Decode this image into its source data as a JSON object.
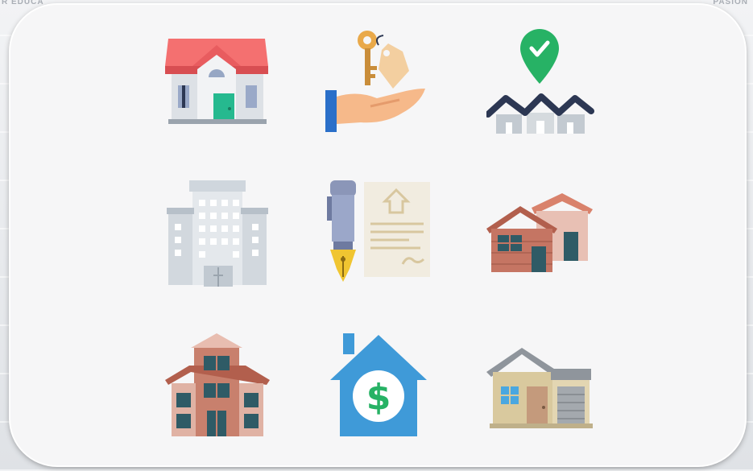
{
  "background": {
    "left_text": "R EDUCA",
    "right_text": "PASION"
  },
  "icons": [
    {
      "name": "house-icon"
    },
    {
      "name": "hand-with-key-icon"
    },
    {
      "name": "location-pin-houses-icon"
    },
    {
      "name": "office-building-icon"
    },
    {
      "name": "pen-and-contract-icon"
    },
    {
      "name": "two-houses-icon"
    },
    {
      "name": "apartment-building-icon"
    },
    {
      "name": "house-dollar-icon"
    },
    {
      "name": "house-with-garage-icon"
    }
  ],
  "colors": {
    "card": "#f6f6f7",
    "roof_red": "#f26b6b",
    "teal": "#26b98f",
    "pin_green": "#27b265",
    "navy": "#2c3753",
    "blue": "#3f9ad8",
    "brick": "#b86a56",
    "sand": "#d7c8a3"
  }
}
